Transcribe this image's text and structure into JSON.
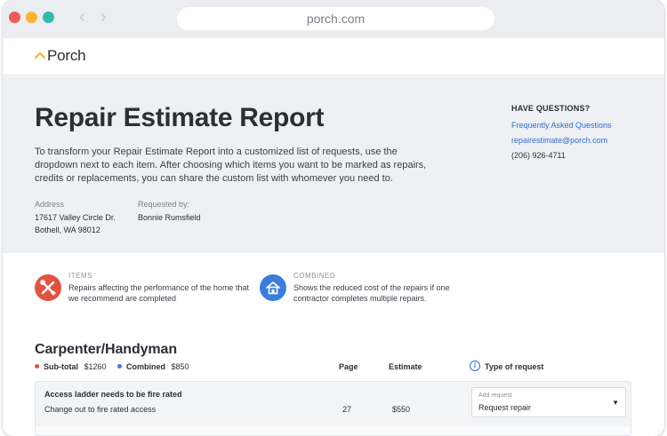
{
  "browser": {
    "url": "porch.com"
  },
  "brand": {
    "logo_text": "Porch",
    "accent": "#f5b730"
  },
  "report": {
    "title": "Repair Estimate Report",
    "intro": "To transform your Repair Estimate Report into a customized list of requests, use the dropdown next to each item. After choosing which items you want to be marked as repairs, credits or replacements, you can share the custom list with whomever you need to.",
    "address_label": "Address",
    "address_line1": "17617 Valley Circle Dr.",
    "address_line2": "Bothell, WA 98012",
    "requested_label": "Requested by:",
    "requested_value": "Bonnie Rumsfield"
  },
  "questions": {
    "title": "HAVE QUESTIONS?",
    "faq": "Frequently Asked Questions",
    "email": "repairestimate@porch.com",
    "phone": "(206) 926-4711"
  },
  "legend": [
    {
      "head": "ITEMS",
      "desc": "Repairs affecting the performance of the home that we recommend are completed",
      "color": "#e0533f",
      "icon": "tools-icon"
    },
    {
      "head": "COMBINED",
      "desc": "Shows the reduced cost of the repairs if one contractor completes multiple repairs.",
      "color": "#3b7ddd",
      "icon": "house-icon"
    }
  ],
  "section": {
    "title": "Carpenter/Handyman",
    "subtotal_label": "Sub-total",
    "subtotal_value": "$1260",
    "subtotal_color": "#e0533f",
    "combined_label": "Combined",
    "combined_value": "$850",
    "combined_color": "#3b7ddd",
    "col_page": "Page",
    "col_estimate": "Estimate",
    "col_type": "Type of request"
  },
  "items": [
    {
      "title": "Access ladder needs to be fire rated",
      "description": "Change out to fire rated access",
      "page": "27",
      "estimate": "$550",
      "select_label": "Add request",
      "select_value": "Request repair"
    }
  ]
}
